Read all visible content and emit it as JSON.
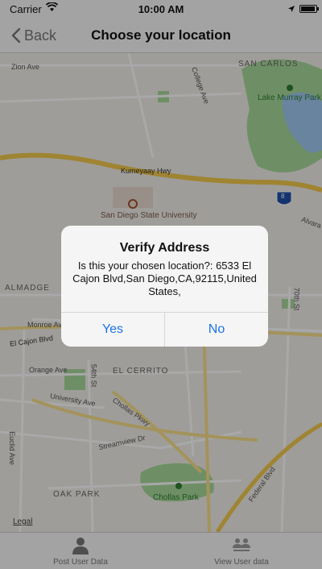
{
  "status_bar": {
    "carrier": "Carrier",
    "time": "10:00 AM"
  },
  "nav": {
    "back_label": "Back",
    "title": "Choose your location"
  },
  "map": {
    "labels": {
      "zion_ave": "Zion Ave",
      "san_carlos": "SAN CARLOS",
      "college_ave": "College Ave",
      "lake_murray_park": "Lake Murray Park",
      "kumeyaay_hwy": "Kumeyaay Hwy",
      "san_diego_state_university": "San Diego State University",
      "interstate_shield": "8",
      "alvarado": "Alvara",
      "talmadge": "ALMADGE",
      "monroe_ave": "Monroe Ave",
      "el_cajon_blvd": "El Cajon Blvd",
      "seventieth_st": "70th St",
      "orange_ave": "Orange Ave",
      "fifty_fourth_st": "54th St",
      "el_cerrito": "EL CERRITO",
      "university_ave": "University Ave",
      "chollas_pkwy": "Chollas Pkwy",
      "streamview_dr": "Streamview Dr",
      "euclid_ave": "Euclid Ave",
      "oak_park": "OAK PARK",
      "chollas_park": "Chollas Park",
      "federal_blvd": "Federal Blvd",
      "legal": "Legal"
    }
  },
  "alert": {
    "title": "Verify Address",
    "message": "Is this your chosen location?: 6533 El Cajon Blvd,San Diego,CA,92115,United States,",
    "yes_label": "Yes",
    "no_label": "No"
  },
  "tab_bar": {
    "post_label": "Post User Data",
    "view_label": "View User data"
  },
  "colors": {
    "accent": "#1a73e8",
    "highway": "#f2c94c",
    "park": "#a8d99a",
    "water": "#9fc8f0"
  }
}
